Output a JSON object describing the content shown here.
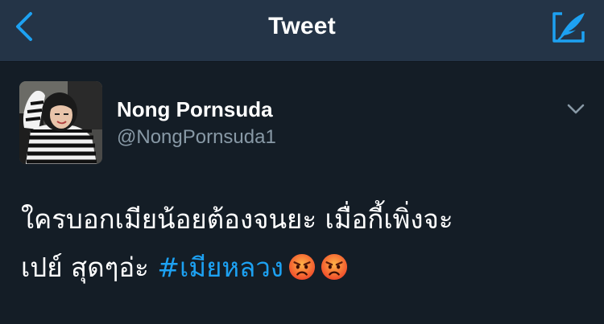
{
  "nav": {
    "title": "Tweet",
    "back_icon": "chevron-left-icon",
    "compose_icon": "compose-quill-icon",
    "accent": "#1da1f2"
  },
  "tweet": {
    "name": "Nong Pornsuda",
    "handle": "@NongPornsuda1",
    "text_line1": "ใครบอกเมียน้อยต้องจนยะ เมื่อกี้เพิ่งจะ",
    "text_line2_plain": "เปย์ สุดๆอ่ะ ",
    "hashtag": "#เมียหลวง",
    "emojis": [
      "angry-face-icon",
      "angry-face-icon"
    ],
    "caret_icon": "chevron-down-icon"
  },
  "colors": {
    "background": "#141d26",
    "navbar": "#243447",
    "text": "#ffffff",
    "muted": "#8899a6",
    "link": "#1da1f2"
  }
}
